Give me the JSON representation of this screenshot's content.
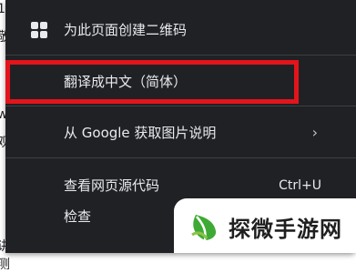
{
  "background": {
    "fragments": [
      "1",
      "敬",
      "w",
      "观",
      "讲测"
    ]
  },
  "menu": {
    "items": [
      {
        "label": "为此页面创建二维码",
        "icon": "qr-code-icon"
      },
      {
        "label": "翻译成中文（简体）"
      },
      {
        "label": "从 Google 获取图片说明",
        "icon": "chevron-right-icon",
        "arrow": "›"
      },
      {
        "label": "查看网页源代码",
        "shortcut": "Ctrl+U"
      },
      {
        "label": "检查"
      }
    ]
  },
  "highlight_color": "#e3141b",
  "watermark": {
    "text": "探微手游网",
    "logo": "leaf-logo"
  }
}
